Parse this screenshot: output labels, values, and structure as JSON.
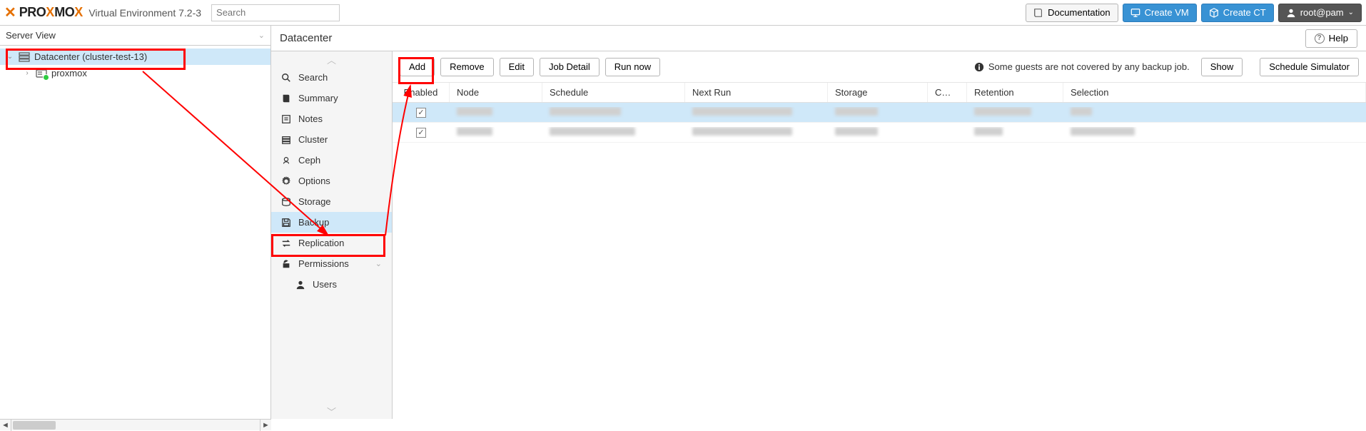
{
  "header": {
    "product_label": "Virtual Environment 7.2-3",
    "search_placeholder": "Search",
    "buttons": {
      "documentation": "Documentation",
      "create_vm": "Create VM",
      "create_ct": "Create CT",
      "user": "root@pam"
    }
  },
  "left_panel": {
    "view_label": "Server View",
    "tree": [
      {
        "id": "dc",
        "label": "Datacenter (cluster-test-13)",
        "icon": "datacenter-icon",
        "selected": true,
        "expanded": true
      },
      {
        "id": "node1",
        "label": "proxmox",
        "icon": "node-icon",
        "parent": "dc"
      }
    ]
  },
  "content": {
    "title": "Datacenter",
    "help_label": "Help",
    "menu": [
      {
        "id": "search",
        "label": "Search",
        "icon": "search-icon"
      },
      {
        "id": "summary",
        "label": "Summary",
        "icon": "book-icon"
      },
      {
        "id": "notes",
        "label": "Notes",
        "icon": "note-icon"
      },
      {
        "id": "cluster",
        "label": "Cluster",
        "icon": "cluster-icon"
      },
      {
        "id": "ceph",
        "label": "Ceph",
        "icon": "ceph-icon"
      },
      {
        "id": "options",
        "label": "Options",
        "icon": "gear-icon"
      },
      {
        "id": "storage",
        "label": "Storage",
        "icon": "storage-icon"
      },
      {
        "id": "backup",
        "label": "Backup",
        "icon": "save-icon",
        "selected": true
      },
      {
        "id": "replication",
        "label": "Replication",
        "icon": "exchange-icon"
      },
      {
        "id": "permissions",
        "label": "Permissions",
        "icon": "unlock-icon",
        "expandable": true
      },
      {
        "id": "users",
        "label": "Users",
        "icon": "user-icon",
        "sub": true
      }
    ],
    "toolbar": {
      "add": "Add",
      "remove": "Remove",
      "edit": "Edit",
      "job_detail": "Job Detail",
      "run_now": "Run now",
      "warning": "Some guests are not covered by any backup job.",
      "show": "Show",
      "schedule_sim": "Schedule Simulator"
    },
    "grid": {
      "columns": {
        "enabled": "Enabled",
        "node": "Node",
        "schedule": "Schedule",
        "next_run": "Next Run",
        "storage": "Storage",
        "c": "C…",
        "retention": "Retention",
        "selection": "Selection"
      },
      "rows": [
        {
          "enabled": true,
          "selected": true
        },
        {
          "enabled": true,
          "selected": false
        }
      ]
    }
  }
}
